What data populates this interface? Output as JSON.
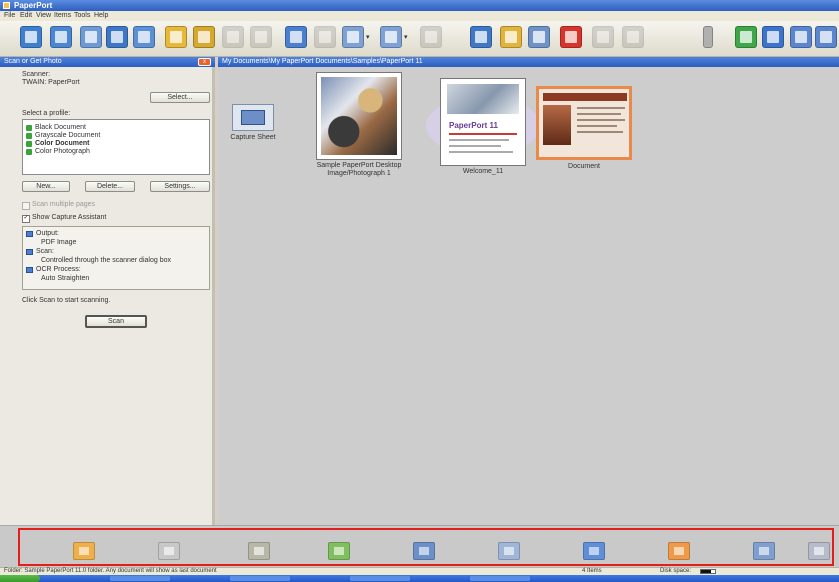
{
  "window": {
    "title": "PaperPort"
  },
  "menu": [
    "File",
    "Edit",
    "View",
    "Items",
    "Tools",
    "Help"
  ],
  "toolbar": {
    "icons": [
      {
        "name": "scan-icon",
        "color": "#3f7fd0",
        "disabled": false
      },
      {
        "name": "get-items-icon",
        "color": "#4a86d4",
        "disabled": false
      },
      {
        "name": "page-icon",
        "color": "#6c9ad8",
        "disabled": false
      },
      {
        "name": "open-icon",
        "color": "#3d78c8",
        "disabled": false
      },
      {
        "name": "copy-icon",
        "color": "#5b8fd6",
        "disabled": false
      },
      {
        "name": "folder-icon",
        "color": "#e8b83a",
        "disabled": false
      },
      {
        "name": "new-folder-icon",
        "color": "#d6a92e",
        "disabled": false
      },
      {
        "name": "cut-icon",
        "color": "#8a8a8a",
        "disabled": true
      },
      {
        "name": "paste-icon",
        "color": "#8a8a8a",
        "disabled": true
      },
      {
        "name": "view-icon",
        "color": "#4b7fcf",
        "disabled": false
      },
      {
        "name": "thumbnails-icon",
        "color": "#8a8a8a",
        "disabled": true
      },
      {
        "name": "page-view-icon",
        "color": "#7fa2d6",
        "disabled": false,
        "dropdown": true
      },
      {
        "name": "zoom-icon",
        "color": "#7fa2d6",
        "disabled": false,
        "dropdown": true
      },
      {
        "name": "rotate-icon",
        "color": "#8a8a8a",
        "disabled": true
      },
      {
        "name": "stack-icon",
        "color": "#3f78c6",
        "disabled": false
      },
      {
        "name": "unstack-icon",
        "color": "#e3b43b",
        "disabled": false
      },
      {
        "name": "properties-icon",
        "color": "#6f93c9",
        "disabled": false
      },
      {
        "name": "delete-icon",
        "color": "#d9342b",
        "disabled": false
      },
      {
        "name": "undo-icon",
        "color": "#8a8a8a",
        "disabled": true
      },
      {
        "name": "search-icon",
        "color": "#8a8a8a",
        "disabled": true
      },
      {
        "name": "chevron-down-icon",
        "color": "#b0b0b0",
        "disabled": false
      },
      {
        "name": "send-to-icon",
        "color": "#3fa64a",
        "disabled": false
      },
      {
        "name": "help-icon",
        "color": "#3b74cc",
        "disabled": false
      },
      {
        "name": "back-icon",
        "color": "#5a86cf",
        "disabled": false
      },
      {
        "name": "forward-icon",
        "color": "#5a86cf",
        "disabled": false
      }
    ]
  },
  "left_pane": {
    "header": "Scan or Get Photo",
    "close_label": "x",
    "scanner_label": "Scanner:",
    "scanner_value": "TWAIN: PaperPort",
    "select_button": "Select...",
    "profile_label": "Select a profile:",
    "profiles": [
      {
        "label": "Black Document",
        "color": "#3aa33a"
      },
      {
        "label": "Grayscale Document",
        "color": "#3aa33a"
      },
      {
        "label": "Color Document",
        "color": "#3aa33a"
      },
      {
        "label": "Color Photograph",
        "color": "#3aa33a"
      }
    ],
    "selected_profile_index": 2,
    "new_button": "New...",
    "delete_button": "Delete...",
    "settings_button": "Settings...",
    "option_multi": "Scan multiple pages",
    "option_assistant": "Show Capture Assistant",
    "option_assistant_checked": "✓",
    "summary": [
      {
        "text": "Output:",
        "icon": true
      },
      {
        "text": "PDF Image",
        "icon": false
      },
      {
        "text": "Scan:",
        "icon": true
      },
      {
        "text": "Controlled through the scanner dialog box",
        "icon": false
      },
      {
        "text": "OCR Process:",
        "icon": true
      },
      {
        "text": "Auto Straighten",
        "icon": false
      }
    ],
    "hint": "Click Scan to start scanning.",
    "scan_button": "Scan"
  },
  "right_pane": {
    "path": "My Documents\\My PaperPort Documents\\Samples\\PaperPort 11",
    "items": {
      "sheet": {
        "label": "Capture Sheet"
      },
      "photo": {
        "label": "Sample PaperPort Desktop Image/Photograph 1"
      },
      "welcome": {
        "label": "Welcome_11",
        "logo_text": "PaperPort 11"
      },
      "document": {
        "label": "Document",
        "selected": true
      }
    }
  },
  "send_to_bar": {
    "icons": [
      {
        "name": "folder-app-icon",
        "color": "#efb04a"
      },
      {
        "name": "window-app-icon",
        "color": "#c8c8c8"
      },
      {
        "name": "pen-app-icon",
        "color": "#b8b8a8"
      },
      {
        "name": "spreadsheet-app-icon",
        "color": "#7fbf5f"
      },
      {
        "name": "email-app-icon",
        "color": "#6d8fc8"
      },
      {
        "name": "edit-app-icon",
        "color": "#9fb6d8"
      },
      {
        "name": "monitor-app-icon",
        "color": "#5e8fd8"
      },
      {
        "name": "pdf-app-icon",
        "color": "#ef9a48"
      },
      {
        "name": "printer-app-icon",
        "color": "#7f9fcf"
      },
      {
        "name": "cd-app-icon",
        "color": "#b6bcc8"
      }
    ]
  },
  "status_bar": {
    "text": "Folder: Sample PaperPort 11.0 folder. Any document will show as last document",
    "items": "4 Items",
    "disk_label": "Disk space:",
    "disk_space_fill": 0.7
  }
}
